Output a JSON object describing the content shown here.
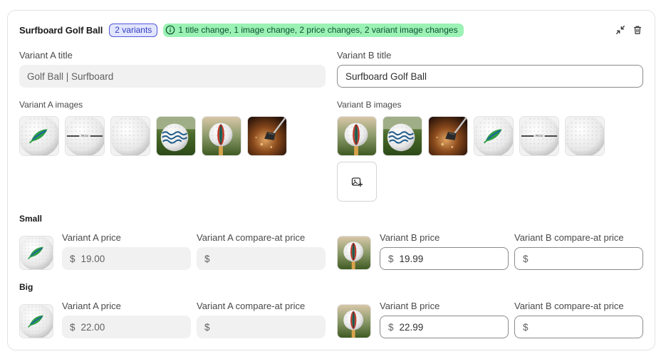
{
  "header": {
    "product_title": "Surfboard Golf Ball",
    "variants_badge": "2 variants",
    "changes_summary": "1 title change, 1 image change, 2 price changes, 2 variant image changes",
    "collapse_icon": "collapse-icon",
    "delete_icon": "trash-icon"
  },
  "title_section": {
    "a_label": "Variant A title",
    "a_value": "Golf Ball | Surfboard",
    "b_label": "Variant B title",
    "b_value": "Surfboard Golf Ball"
  },
  "images_section": {
    "a_label": "Variant A images",
    "b_label": "Variant B images",
    "a_images": [
      "ball-leaf",
      "ball-logo-line",
      "ball-plain",
      "ball-waves-grass",
      "ball-surfboard-tee",
      "club-sand"
    ],
    "b_images": [
      "ball-surfboard-tee",
      "ball-waves-grass",
      "club-sand",
      "ball-leaf",
      "ball-logo-line",
      "ball-plain"
    ],
    "add_media_icon": "add-image-icon"
  },
  "variants": [
    {
      "name": "Small",
      "a_image": "ball-leaf",
      "b_image": "ball-surfboard-tee",
      "a_price_label": "Variant A price",
      "a_price": "19.00",
      "a_compare_label": "Variant A compare-at price",
      "a_compare": "",
      "b_price_label": "Variant B price",
      "b_price": "19.99",
      "b_compare_label": "Variant B compare-at price",
      "b_compare": "",
      "currency": "$"
    },
    {
      "name": "Big",
      "a_image": "ball-leaf",
      "b_image": "ball-surfboard-tee",
      "a_price_label": "Variant A price",
      "a_price": "22.00",
      "a_compare_label": "Variant A compare-at price",
      "a_compare": "",
      "b_price_label": "Variant B price",
      "b_price": "22.99",
      "b_compare_label": "Variant B compare-at price",
      "b_compare": "",
      "currency": "$"
    }
  ],
  "colors": {
    "badge_blue_bg": "#e2e5ff",
    "badge_blue_border": "#4f55d6",
    "badge_green_bg": "#9bf2b4",
    "disabled_field": "#f1f1f1"
  }
}
